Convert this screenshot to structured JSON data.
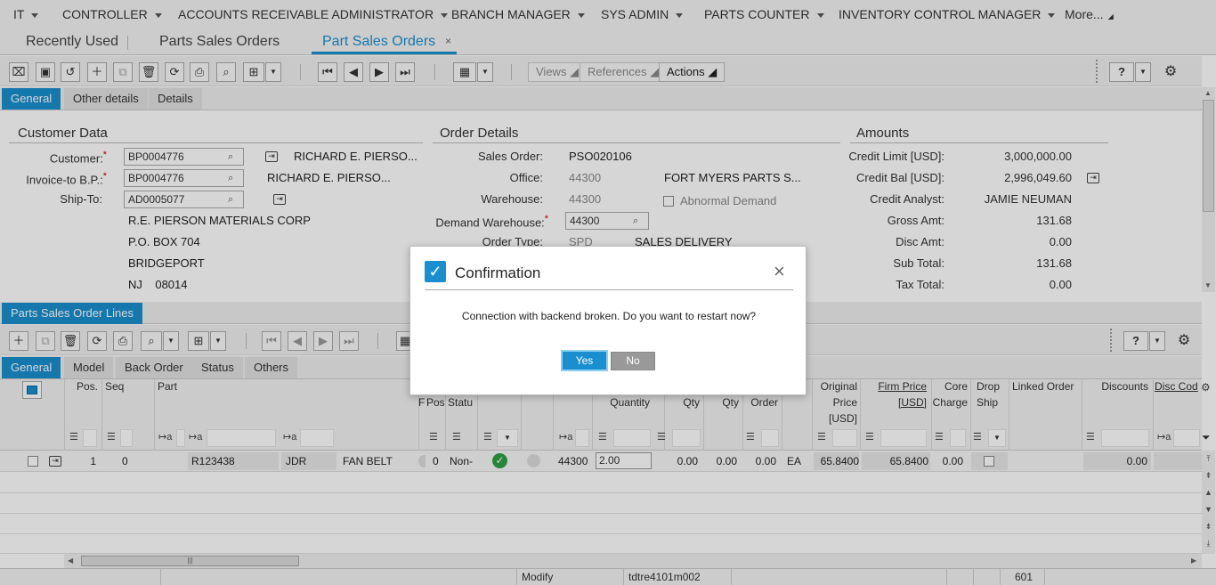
{
  "menubar": {
    "items": [
      {
        "label": "IT",
        "caret": true
      },
      {
        "label": "CONTROLLER",
        "caret": true
      },
      {
        "label": "ACCOUNTS RECEIVABLE ADMINISTRATOR",
        "caret": true
      },
      {
        "label": "BRANCH MANAGER",
        "caret": true
      },
      {
        "label": "SYS ADMIN",
        "caret": true
      },
      {
        "label": "PARTS COUNTER",
        "caret": true
      },
      {
        "label": "INVENTORY CONTROL MANAGER",
        "caret": true
      },
      {
        "label": "More...",
        "caret": false
      }
    ]
  },
  "page_tabs": {
    "recent": "Recently Used",
    "tab1": "Parts Sales Orders",
    "tab2": "Part Sales Orders",
    "close": "×"
  },
  "toolbar": {
    "views": "Views",
    "references": "References",
    "actions": "Actions",
    "help": "?"
  },
  "header_tabs": [
    "General",
    "Other details",
    "Details"
  ],
  "customer_data": {
    "title": "Customer Data",
    "customer_label": "Customer:",
    "customer_value": "BP0004776",
    "customer_name": "RICHARD E. PIERSO...",
    "invoice_label": "Invoice-to B.P.:",
    "invoice_value": "BP0004776",
    "invoice_name": "RICHARD E. PIERSO...",
    "shipto_label": "Ship-To:",
    "shipto_value": "AD0005077",
    "addr1": "R.E. PIERSON MATERIALS CORP",
    "addr2": "P.O. BOX 704",
    "addr3": "BRIDGEPORT",
    "addr4": "NJ    08014"
  },
  "order_details": {
    "title": "Order Details",
    "sales_order_label": "Sales Order:",
    "sales_order_value": "PSO020106",
    "office_label": "Office:",
    "office_value": "44300",
    "office_name": "FORT MYERS PARTS S...",
    "warehouse_label": "Warehouse:",
    "warehouse_value": "44300",
    "abnormal_label": "Abnormal Demand",
    "demand_wh_label": "Demand Warehouse:",
    "demand_wh_value": "44300",
    "order_type_label": "Order Type:",
    "order_type_value": "SPD",
    "order_type_name": "SALES DELIVERY"
  },
  "amounts": {
    "title": "Amounts",
    "rows": [
      {
        "label": "Credit Limit [USD]:",
        "value": "3,000,000.00"
      },
      {
        "label": "Credit Bal [USD]:",
        "value": "2,996,049.60"
      },
      {
        "label": "Credit Analyst:",
        "value": "JAMIE NEUMAN"
      },
      {
        "label": "Gross Amt:",
        "value": "131.68"
      },
      {
        "label": "Disc Amt:",
        "value": "0.00"
      },
      {
        "label": "Sub Total:",
        "value": "131.68"
      },
      {
        "label": "Tax Total:",
        "value": "0.00"
      }
    ]
  },
  "lines": {
    "title": "Parts Sales Order Lines",
    "tabs": [
      "General",
      "Model",
      "Back Order",
      "Status",
      "Others"
    ],
    "headers": {
      "pos": "Pos.",
      "seq": "Seq",
      "part": "Part",
      "f": "F",
      "pos2": "Pos",
      "status": "Statu",
      "quantity": "Quantity",
      "qty1": "Qty",
      "qty2": "Qty",
      "order": "Order",
      "orig1": "Original",
      "orig2": "Price",
      "orig3": "[USD]",
      "firm1": "Firm Price",
      "firm2": "[USD]",
      "core1": "Core",
      "core2": "Charge",
      "drop1": "Drop",
      "drop2": "Ship",
      "linked": "Linked Order",
      "discounts": "Discounts",
      "disccode": "Disc Cod"
    },
    "row": {
      "pos": "1",
      "seq": "0",
      "part": "R123438",
      "brand": "JDR",
      "desc": "FAN BELT",
      "pos2": "0",
      "status": "Non-",
      "warehouse": "44300",
      "quantity": "2.00",
      "qty1": "0.00",
      "qty2": "0.00",
      "order_qty": "0.00",
      "unit": "EA",
      "orig_price": "65.8400",
      "firm_price": "65.8400",
      "core": "0.00",
      "discounts": "0.00"
    }
  },
  "statusbar": {
    "mode": "Modify",
    "session": "tdtre4101m002",
    "count": "601"
  },
  "dialog": {
    "title": "Confirmation",
    "message": "Connection with backend broken. Do you want to restart now?",
    "yes": "Yes",
    "no": "No",
    "close": "×"
  },
  "colors": {
    "accent": "#1a8fcf",
    "required": "#cc0000",
    "ok_green": "#2ea043"
  }
}
